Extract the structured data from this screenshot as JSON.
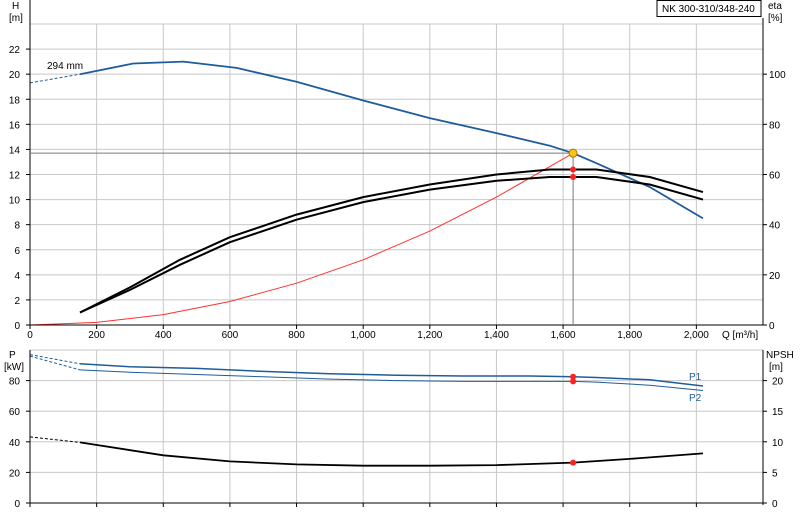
{
  "title": "NK 300-310/348-240",
  "chart_data": [
    {
      "type": "line",
      "panel": "head-efficiency",
      "xlabel": "Q [m³/h]",
      "ylabel_left_name": "H",
      "ylabel_left_unit": "[m]",
      "ylabel_right_name": "eta",
      "ylabel_right_unit": "[%]",
      "xlim": [
        0,
        2200
      ],
      "ylim_left": [
        0,
        24
      ],
      "ylim_right": [
        0,
        120
      ],
      "x_ticks": [
        0,
        200,
        400,
        600,
        800,
        1000,
        1200,
        1400,
        1600,
        1800,
        2000
      ],
      "x_tick_labels": [
        "0",
        "200",
        "400",
        "600",
        "800",
        "1,000",
        "1,200",
        "1,400",
        "1,600",
        "1,800",
        "2,000"
      ],
      "y_left_ticks": [
        0,
        2,
        4,
        6,
        8,
        10,
        12,
        14,
        16,
        18,
        20,
        22
      ],
      "y_right_ticks": [
        0,
        20,
        40,
        60,
        80,
        100
      ],
      "grid": true,
      "annotations": [
        {
          "text": "294 mm",
          "x": 110,
          "y": 20.7
        }
      ],
      "duty_point": {
        "q": 1630,
        "h": 13.7,
        "eta": 74
      },
      "series": [
        {
          "id": "head",
          "axis": "left",
          "color": "#1f5c9a",
          "width": 1.8,
          "x": [
            150,
            310,
            460,
            620,
            800,
            1000,
            1200,
            1400,
            1560,
            1630,
            1700,
            1860,
            2020
          ],
          "y": [
            20.0,
            20.85,
            21.0,
            20.5,
            19.4,
            17.9,
            16.5,
            15.3,
            14.3,
            13.7,
            12.9,
            11.0,
            8.5
          ]
        },
        {
          "id": "head-extrapolated",
          "axis": "left",
          "color": "#1f5c9a",
          "width": 1,
          "dashed": true,
          "x": [
            0,
            150
          ],
          "y": [
            19.3,
            20.0
          ]
        },
        {
          "id": "system-curve",
          "axis": "left",
          "color": "#ff3030",
          "width": 1,
          "x": [
            0,
            200,
            400,
            600,
            800,
            1000,
            1200,
            1400,
            1630
          ],
          "y": [
            0,
            0.21,
            0.83,
            1.87,
            3.33,
            5.2,
            7.49,
            10.2,
            13.7
          ]
        },
        {
          "id": "efficiency-1",
          "axis": "right",
          "color": "#000000",
          "width": 2,
          "x": [
            150,
            300,
            450,
            600,
            800,
            1000,
            1200,
            1400,
            1560,
            1630,
            1700,
            1860,
            2020
          ],
          "y": [
            5,
            15,
            26,
            35,
            44,
            51,
            56,
            60,
            62,
            62,
            62,
            59,
            53
          ]
        },
        {
          "id": "efficiency-2",
          "axis": "right",
          "color": "#000000",
          "width": 2,
          "x": [
            150,
            300,
            450,
            600,
            800,
            1000,
            1200,
            1400,
            1560,
            1630,
            1700,
            1860,
            2020
          ],
          "y": [
            5,
            14,
            24,
            33,
            42,
            49,
            54,
            57.5,
            59,
            59,
            59,
            56,
            50
          ]
        }
      ]
    },
    {
      "type": "line",
      "panel": "power-npsh",
      "xlim": [
        0,
        2200
      ],
      "ylabel_left_name": "P",
      "ylabel_left_unit": "[kW]",
      "ylabel_right_name": "NPSH",
      "ylabel_right_unit": "[m]",
      "ylim_left": [
        0,
        100
      ],
      "ylim_right": [
        0,
        25
      ],
      "y_left_ticks": [
        0,
        20,
        40,
        60,
        80
      ],
      "y_right_ticks": [
        0,
        5,
        10,
        15,
        20
      ],
      "grid": true,
      "series": [
        {
          "id": "P1",
          "name": "P1",
          "axis": "left",
          "color": "#1f5c9a",
          "width": 1.5,
          "x": [
            150,
            300,
            500,
            700,
            900,
            1100,
            1300,
            1500,
            1630,
            1700,
            1860,
            2020
          ],
          "y": [
            91,
            89,
            88,
            86,
            84.5,
            83.5,
            83,
            83,
            82.5,
            82,
            80.5,
            76.5
          ]
        },
        {
          "id": "P2",
          "name": "P2",
          "axis": "left",
          "color": "#1f5c9a",
          "width": 1,
          "x": [
            150,
            300,
            500,
            700,
            900,
            1100,
            1300,
            1500,
            1630,
            1700,
            1860,
            2020
          ],
          "y": [
            87,
            85.5,
            84,
            82.5,
            81,
            80,
            79.5,
            79.5,
            79.5,
            79,
            77,
            73.5
          ]
        },
        {
          "id": "P1-extrapolated",
          "axis": "left",
          "color": "#1f5c9a",
          "width": 1,
          "dashed": true,
          "x": [
            0,
            150
          ],
          "y": [
            97,
            91
          ]
        },
        {
          "id": "P2-extrapolated",
          "axis": "left",
          "color": "#1f5c9a",
          "width": 1,
          "dashed": true,
          "x": [
            0,
            150
          ],
          "y": [
            96,
            87
          ]
        },
        {
          "id": "NPSH",
          "axis": "right",
          "color": "#000000",
          "width": 1.8,
          "x": [
            150,
            400,
            600,
            800,
            1000,
            1200,
            1400,
            1630,
            1800,
            2020
          ],
          "y": [
            9.9,
            7.8,
            6.8,
            6.3,
            6.1,
            6.1,
            6.2,
            6.6,
            7.2,
            8.1
          ]
        },
        {
          "id": "NPSH-extrapolated",
          "axis": "right",
          "color": "#000000",
          "width": 1,
          "dashed": true,
          "x": [
            0,
            150
          ],
          "y": [
            10.8,
            9.9
          ]
        }
      ],
      "duty_point": {
        "q": 1630,
        "p1": 82.5,
        "p2": 79.5,
        "npsh": 6.6
      }
    }
  ]
}
